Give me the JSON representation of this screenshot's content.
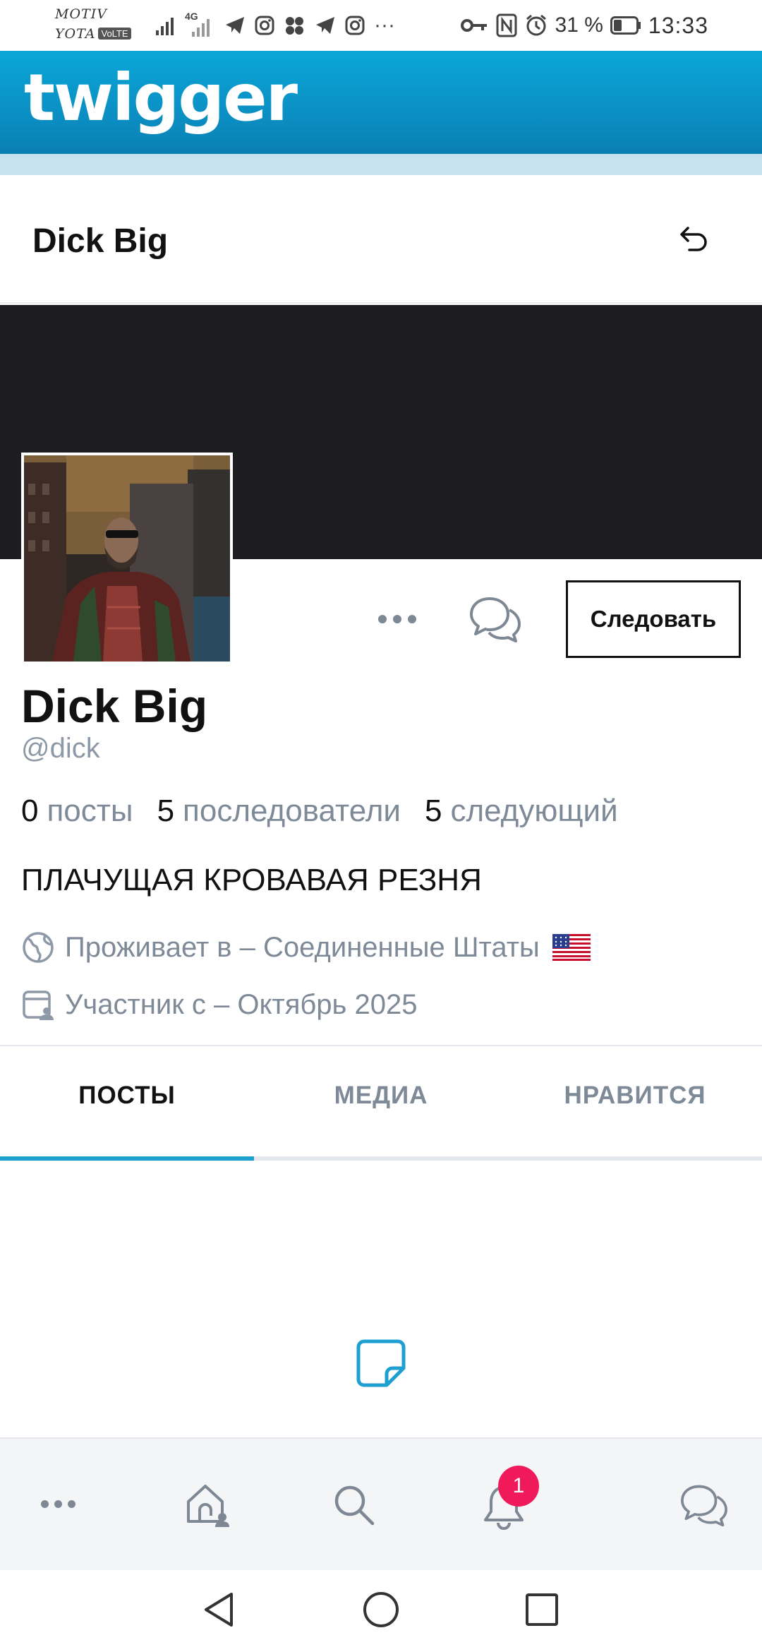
{
  "status_bar": {
    "carrier_line1": "MOTIV",
    "carrier_line2": "YOTA",
    "volte": "VoLTE",
    "network": "4G",
    "more": "···",
    "battery": "31 %",
    "time": "13:33"
  },
  "app": {
    "logo": "twigger"
  },
  "profile_header": {
    "title": "Dick Big",
    "back_icon": "undo-arrow-icon"
  },
  "profile": {
    "display_name": "Dick Big",
    "handle": "@dick",
    "follow_label": "Следовать",
    "stats": [
      {
        "count": "0",
        "label": "посты"
      },
      {
        "count": "5",
        "label": "последователи"
      },
      {
        "count": "5",
        "label": "следующий"
      }
    ],
    "bio": "ПЛАЧУЩАЯ КРОВАВАЯ РЕЗНЯ",
    "location": "Проживает в – Соединенные Штаты",
    "joined": "Участник с – Октябрь 2025"
  },
  "tabs": [
    {
      "label": "ПОСТЫ",
      "active": true
    },
    {
      "label": "МЕДИА",
      "active": false
    },
    {
      "label": "НРАВИТСЯ",
      "active": false
    }
  ],
  "bottom_nav": {
    "notification_badge": "1",
    "items": [
      "more-icon",
      "home-icon",
      "search-icon",
      "bell-icon",
      "chat-icon"
    ]
  },
  "colors": {
    "brand": "#0b8cc0",
    "accent": "#1da0cf",
    "muted_text": "#7e8a97",
    "badge": "#f0195a"
  }
}
